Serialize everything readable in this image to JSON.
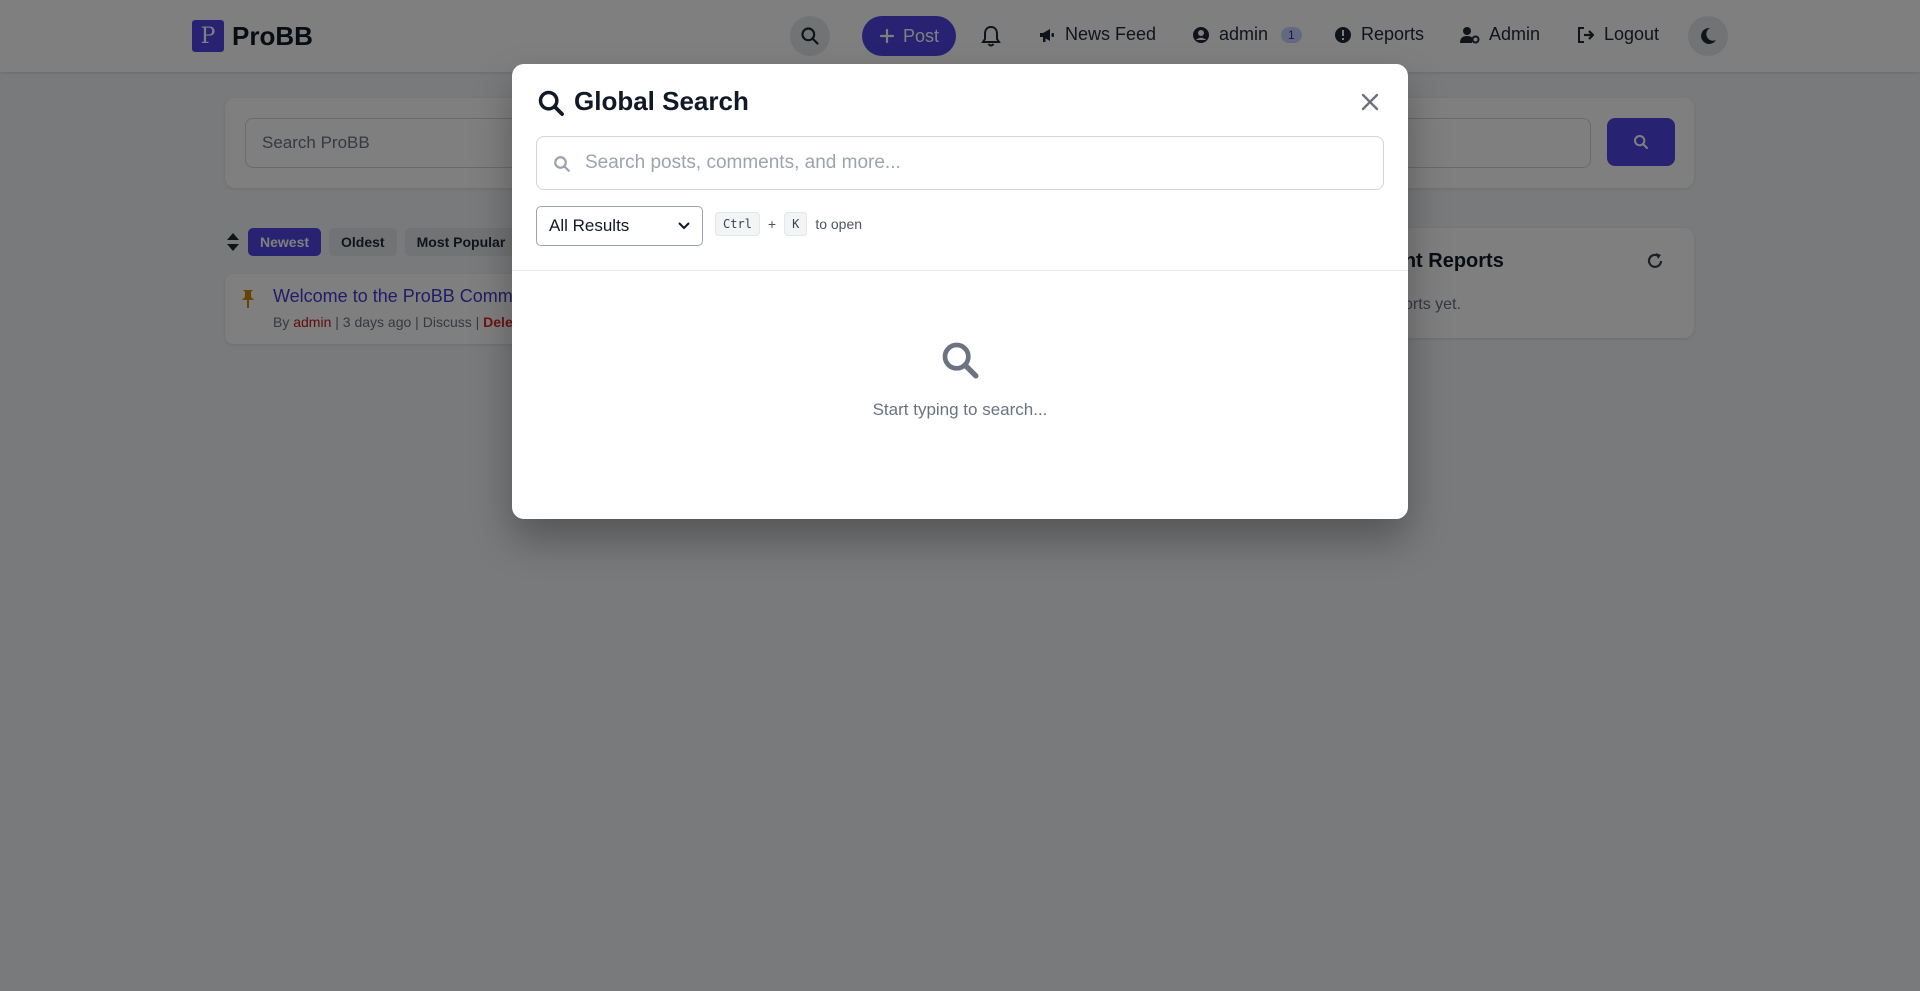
{
  "navbar": {
    "brand_logo": "P",
    "brand_name": "ProBB",
    "post_label": "Post",
    "newsfeed_label": "News Feed",
    "user_label": "admin",
    "user_badge": "1",
    "reports_label": "Reports",
    "admin_label": "Admin",
    "logout_label": "Logout"
  },
  "search_card": {
    "placeholder": "Search ProBB"
  },
  "sort": {
    "options": [
      "Newest",
      "Oldest",
      "Most Popular"
    ],
    "active": "Newest"
  },
  "post": {
    "title": "Welcome to the ProBB Community",
    "meta_by": "By",
    "author": "admin",
    "time": "3 days ago",
    "action": "Discuss",
    "delete_label": "Delete"
  },
  "side_panel": {
    "title": "Recent Reports",
    "empty_text": "No reports yet."
  },
  "modal": {
    "title": "Global Search",
    "placeholder": "Search posts, comments, and more...",
    "filter_selected": "All Results",
    "hint_key1": "Ctrl",
    "hint_plus": "+",
    "hint_key2": "K",
    "hint_text": "to open",
    "empty_text": "Start typing to search..."
  },
  "colors": {
    "accent": "#4f46e5",
    "overlay": "rgba(0,0,0,0.5)"
  }
}
